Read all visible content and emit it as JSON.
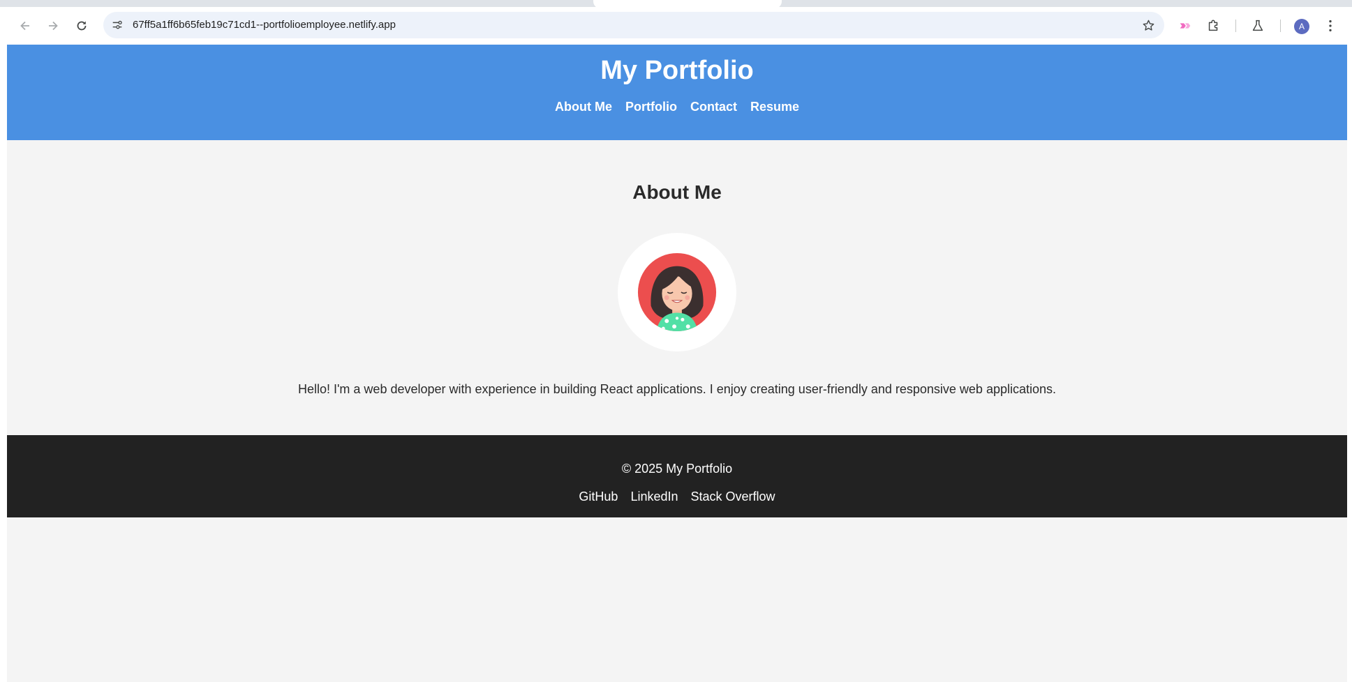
{
  "browser": {
    "url": "67ff5a1ff6b65feb19c71cd1--portfolioemployee.netlify.app",
    "avatar_letter": "A",
    "icons": [
      "back-arrow-icon",
      "forward-arrow-icon",
      "reload-icon",
      "site-info-icon",
      "bookmark-star-icon",
      "extension-icon",
      "puzzle-icon",
      "labs-flask-icon",
      "kebab-menu-icon"
    ]
  },
  "header": {
    "title": "My Portfolio",
    "nav": [
      "About Me",
      "Portfolio",
      "Contact",
      "Resume"
    ]
  },
  "about": {
    "title": "About Me",
    "text": "Hello! I'm a web developer with experience in building React applications. I enjoy creating user-friendly and responsive web applications."
  },
  "footer": {
    "copyright": "© 2025 My Portfolio",
    "links": [
      "GitHub",
      "LinkedIn",
      "Stack Overflow"
    ]
  },
  "colors": {
    "header_bg": "#4a90e2",
    "page_bg": "#f4f4f4",
    "footer_bg": "#222222",
    "avatar_ring": "#ec4e4e",
    "shirt": "#52e0a6"
  }
}
